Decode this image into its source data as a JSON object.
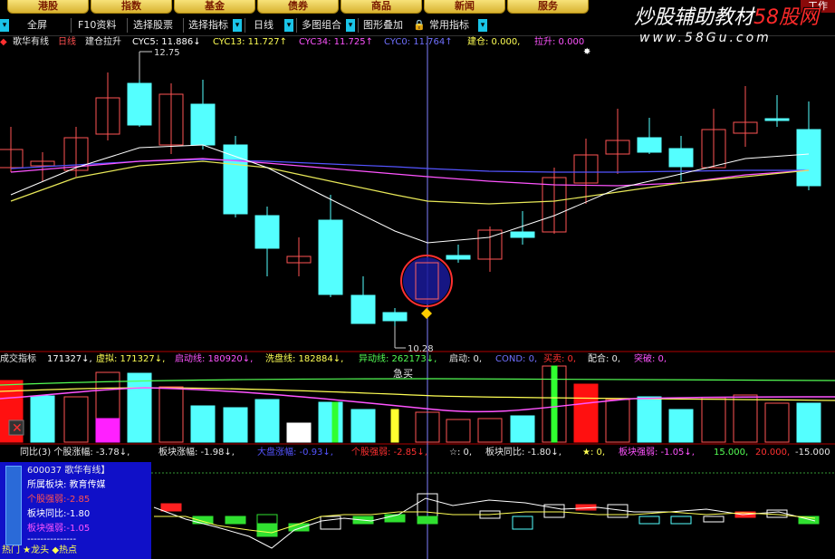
{
  "nav": {
    "items": [
      "港股",
      "指数",
      "基金",
      "债券",
      "商品",
      "新闻",
      "服务"
    ],
    "work": "工作"
  },
  "toolbar": {
    "fullscreen": "全屏",
    "f10": "F10资料",
    "select_stock": "选择股票",
    "select_indicator": "选择指标",
    "period": "日线",
    "multi_chart": "多图组合",
    "overlay": "图形叠加",
    "common_indicators": "常用指标"
  },
  "watermark": {
    "text": "炒股辅助教材",
    "brand": "58股网",
    "url": "www.58Gu.com"
  },
  "main_info": {
    "stock": "歌华有线",
    "period": "日线",
    "indicator": "建仓拉升",
    "cyc5": "CYC5: 11.886↓",
    "cyc13": "CYC13: 11.727↑",
    "cyc34": "CYC34: 11.725↑",
    "cyc0": "CYC0: 11.764↑",
    "jiancang": "建仓: 0.000,",
    "lasheng": "拉升: 0.000",
    "high_label": "12.75",
    "low_label": "10.28"
  },
  "volume_info": {
    "title": "成交指标",
    "vol": "171327↓,",
    "xuni": "虚拟: 171327↓,",
    "qidong": "启动线: 180920↓,",
    "xipan": "洗盘线: 182884↓,",
    "yidong": "异动线: 262173↓,",
    "qidong2": "启动: 0,",
    "cond": "COND: 0,",
    "maimai": "买卖: 0,",
    "peihe": "配合: 0,",
    "tupo": "突破: 0,",
    "jimai": "急买"
  },
  "strength_info": {
    "title": "同比(3) 个股涨幅: -3.78↓,",
    "bankuai": "板块涨幅: -1.98↓,",
    "dapan": "大盘涨幅: -0.93↓,",
    "gegu_qr": "个股强弱: -2.85↓,",
    "star": "☆: 0,",
    "bk_tongbi": "板块同比: -1.80↓,",
    "star2": "★: 0,",
    "bk_qr": "板块强弱: -1.05↓,",
    "n15": "15.000,",
    "n20": "20.000,",
    "nm15": "-15.000"
  },
  "panel": {
    "code": "600037 歌华有线】",
    "sector": "所属板块: 教育传媒",
    "gegu_qr": "个股强弱:-2.85",
    "bk_tongbi": "板块同比:-1.80",
    "bk_qr": "板块强弱:-1.05",
    "divider": "---------------",
    "legend": "热门 ★龙头 ◆热点"
  },
  "colors": {
    "up": "#ff5454",
    "down": "#54ffff",
    "ma_white": "#ffffff",
    "ma_yellow": "#ffff54",
    "ma_magenta": "#ff54ff",
    "ma_blue": "#5454ff"
  }
}
